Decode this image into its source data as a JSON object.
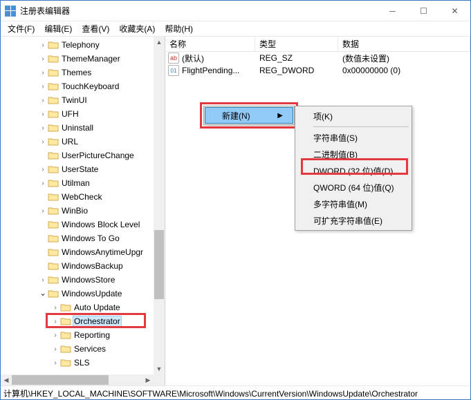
{
  "window": {
    "title": "注册表编辑器"
  },
  "menu": {
    "file": "文件(F)",
    "edit": "编辑(E)",
    "view": "查看(V)",
    "favorites": "收藏夹(A)",
    "help": "帮助(H)"
  },
  "tree": {
    "items": [
      {
        "label": "Telephony",
        "expand": "right",
        "indent": 3
      },
      {
        "label": "ThemeManager",
        "expand": "right",
        "indent": 3
      },
      {
        "label": "Themes",
        "expand": "right",
        "indent": 3
      },
      {
        "label": "TouchKeyboard",
        "expand": "right",
        "indent": 3
      },
      {
        "label": "TwinUI",
        "expand": "right",
        "indent": 3
      },
      {
        "label": "UFH",
        "expand": "right",
        "indent": 3
      },
      {
        "label": "Uninstall",
        "expand": "right",
        "indent": 3
      },
      {
        "label": "URL",
        "expand": "right",
        "indent": 3
      },
      {
        "label": "UserPictureChange",
        "expand": "none",
        "indent": 3
      },
      {
        "label": "UserState",
        "expand": "right",
        "indent": 3
      },
      {
        "label": "Utilman",
        "expand": "right",
        "indent": 3
      },
      {
        "label": "WebCheck",
        "expand": "none",
        "indent": 3
      },
      {
        "label": "WinBio",
        "expand": "right",
        "indent": 3
      },
      {
        "label": "Windows Block Level",
        "expand": "none",
        "indent": 3
      },
      {
        "label": "Windows To Go",
        "expand": "none",
        "indent": 3
      },
      {
        "label": "WindowsAnytimeUpgr",
        "expand": "none",
        "indent": 3
      },
      {
        "label": "WindowsBackup",
        "expand": "none",
        "indent": 3
      },
      {
        "label": "WindowsStore",
        "expand": "right",
        "indent": 3
      },
      {
        "label": "WindowsUpdate",
        "expand": "down",
        "indent": 3
      },
      {
        "label": "Auto Update",
        "expand": "right",
        "indent": 4
      },
      {
        "label": "Orchestrator",
        "expand": "right",
        "indent": 4,
        "selected": true
      },
      {
        "label": "Reporting",
        "expand": "right",
        "indent": 4
      },
      {
        "label": "Services",
        "expand": "right",
        "indent": 4
      },
      {
        "label": "SLS",
        "expand": "right",
        "indent": 4
      }
    ]
  },
  "list": {
    "headers": {
      "name": "名称",
      "type": "类型",
      "data": "数据"
    },
    "rows": [
      {
        "icon": "ab",
        "name": "(默认)",
        "type": "REG_SZ",
        "data": "(数值未设置)"
      },
      {
        "icon": "bin",
        "name": "FlightPending...",
        "type": "REG_DWORD",
        "data": "0x00000000 (0)"
      }
    ]
  },
  "context": {
    "new": "新建(N)",
    "sub": {
      "key": "项(K)",
      "string": "字符串值(S)",
      "binary": "二进制值(B)",
      "dword": "DWORD (32 位)值(D)",
      "qword": "QWORD (64 位)值(Q)",
      "multi": "多字符串值(M)",
      "expand": "可扩充字符串值(E)"
    }
  },
  "status": {
    "path": "计算机\\HKEY_LOCAL_MACHINE\\SOFTWARE\\Microsoft\\Windows\\CurrentVersion\\WindowsUpdate\\Orchestrator"
  }
}
